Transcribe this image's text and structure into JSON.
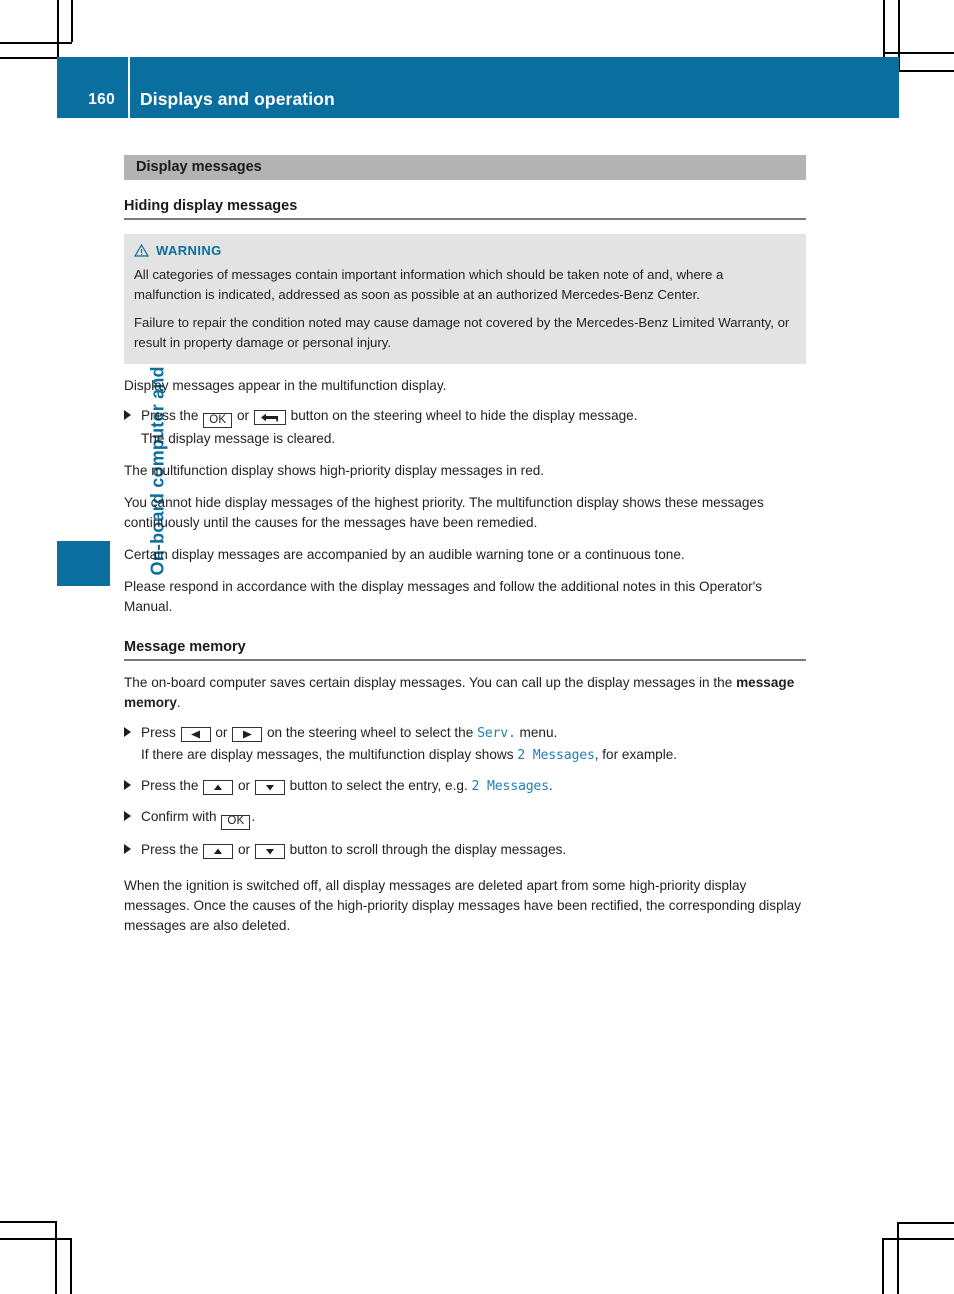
{
  "header": {
    "page_number": "160",
    "title": "Displays and operation"
  },
  "side": {
    "chapter_label": "On-board computer and displays"
  },
  "section": {
    "bar_title": "Display messages"
  },
  "subsections": [
    {
      "title": "Hiding display messages"
    },
    {
      "title": "Message memory"
    }
  ],
  "warning": {
    "icon": "warning-triangle-icon",
    "label": "WARNING",
    "paragraphs": [
      "All categories of messages contain important information which should be taken note of and, where a malfunction is indicated, addressed as soon as possible at an authorized Mercedes-Benz Center.",
      "Failure to repair the condition noted may cause damage not covered by the Mercedes-Benz Limited Warranty, or result in property damage or personal injury."
    ]
  },
  "hiding": {
    "intro": "Display messages appear in the multifunction display.",
    "step1": {
      "lead": "Press the",
      "key_ok": "OK",
      "or": "or",
      "key_back": "back-arrow-icon",
      "tail": "button on the steering wheel to hide the display message.",
      "result": "The display message is cleared."
    },
    "paragraphs": [
      "The multifunction display shows high-priority display messages in red.",
      "You cannot hide display messages of the highest priority. The multifunction display shows these messages continuously until the causes for the messages have been remedied.",
      "Certain display messages are accompanied by an audible warning tone or a continuous tone.",
      "Please respond in accordance with the display messages and follow the additional notes in this Operator's Manual."
    ]
  },
  "memory": {
    "intro_a": "The on-board computer saves certain display messages. You can call up the display messages in the",
    "intro_bold": "message memory",
    "intro_b": ".",
    "step1": {
      "lead": "Press",
      "key_left": "arrow-left-icon",
      "or": "or",
      "key_right": "arrow-right-icon",
      "tail": "on the steering wheel to select the",
      "screen_text": "Serv.",
      "tail2": "menu.",
      "result_a": "If there are display messages, the multifunction display shows",
      "result_screen": "2 Messages",
      "result_b": ", for example."
    },
    "step2": {
      "lead": "Press the",
      "key_up": "arrow-up-icon",
      "or": "or",
      "key_down": "arrow-down-icon",
      "tail": "button to select the entry, e.g.",
      "screen_text": "2 Messages",
      "tail2": "."
    },
    "step3": {
      "lead": "Confirm with",
      "key_ok": "OK",
      "tail": "."
    },
    "step4": {
      "lead": "Press the",
      "key_up": "arrow-up-icon",
      "or": "or",
      "key_down": "arrow-down-icon",
      "tail": "button to scroll through the display messages."
    },
    "outro": "When the ignition is switched off, all display messages are deleted apart from some high-priority display messages. Once the causes of the high-priority display messages have been rectified, the corresponding display messages are also deleted."
  },
  "colors": {
    "brand_blue": "#0a6e9e",
    "screen_blue": "#1f7fb6",
    "section_gray": "#b3b3b3",
    "warning_gray": "#e3e3e3"
  }
}
